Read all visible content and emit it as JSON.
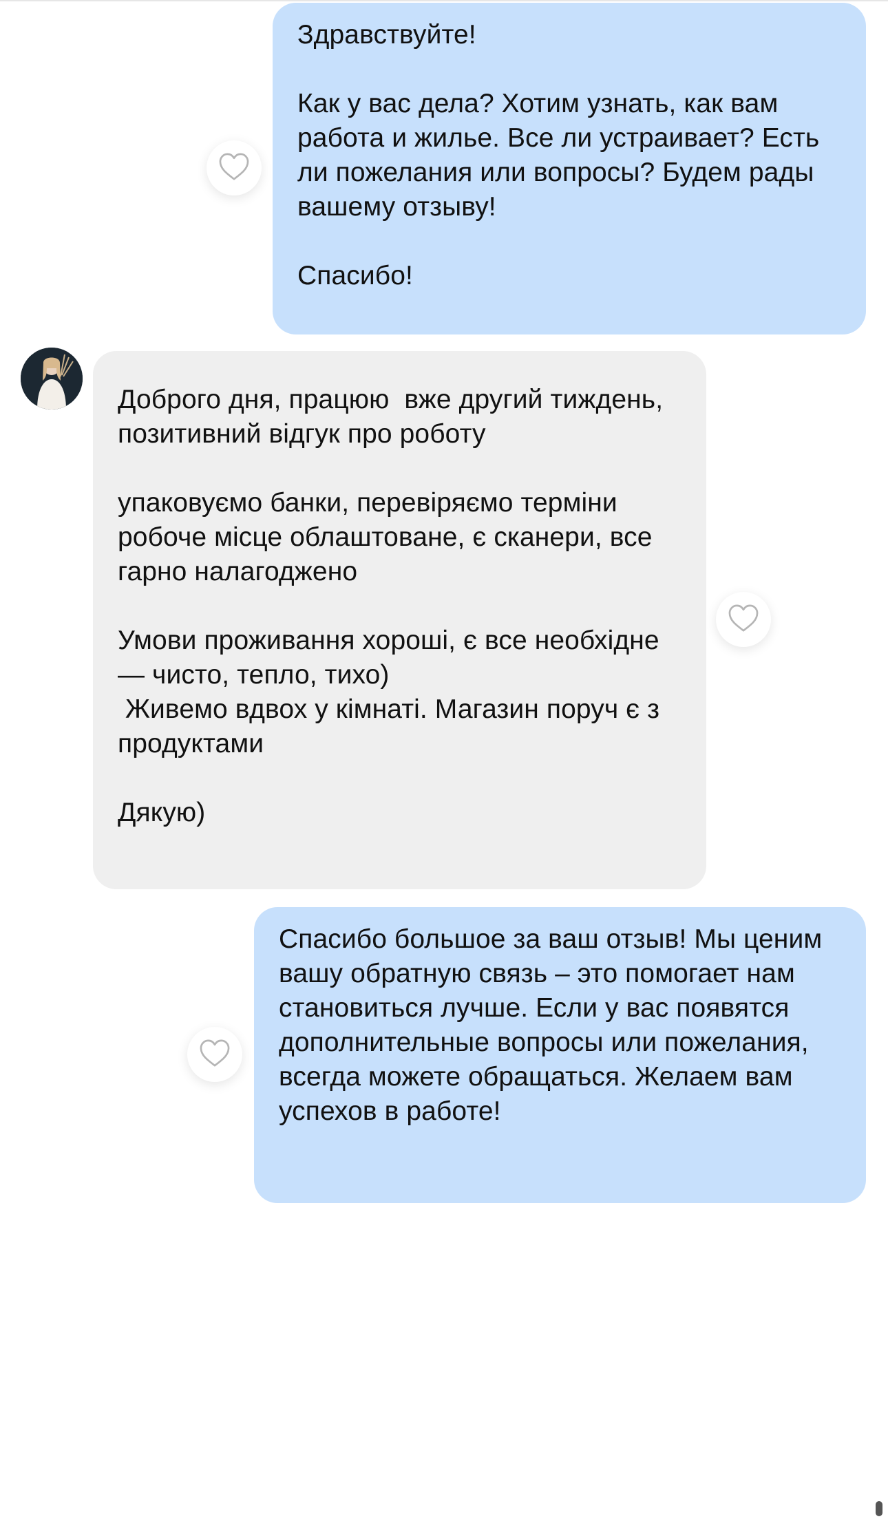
{
  "conversation": {
    "messages": [
      {
        "direction": "outgoing",
        "text": "Здравствуйте!\n\nКак у вас дела? Хотим узнать, как вам работа и жилье. Все ли устраивает? Есть ли пожелания или вопросы? Будем рады вашему отзыву!\n\nСпасибо!"
      },
      {
        "direction": "incoming",
        "text": "Доброго дня, працюю  вже другий тиждень, позитивний відгук про роботу\n\nупаковуємо банки, перевіряємо терміни робоче місце облаштоване, є сканери, все гарно налагоджено\n\nУмови проживання хороші, є все необхідне — чисто, тепло, тихо)\n Живемо вдвох у кімнаті. Магазин поруч є з продуктами\n\nДякую)"
      },
      {
        "direction": "outgoing",
        "text": "Спасибо большое за ваш отзыв! Мы ценим вашу обратную связь – это помогает нам становиться лучше. Если у вас появятся дополнительные вопросы или пожелания, всегда можете обращаться. Желаем вам успехов в работе!"
      }
    ]
  },
  "icons": {
    "like": "heart-icon",
    "avatar": "avatar"
  },
  "colors": {
    "outgoing_bubble": "#c7e0fc",
    "incoming_bubble": "#efefef",
    "background": "#ffffff",
    "text": "#111111",
    "heart_outline": "#b5b5b5"
  }
}
